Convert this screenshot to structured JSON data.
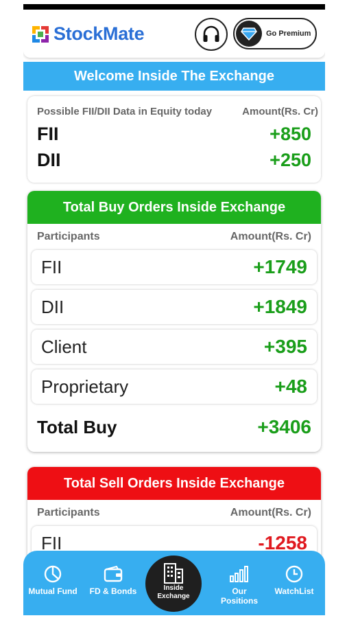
{
  "app": {
    "name": "StockMate",
    "premium_label": "Go Premium"
  },
  "welcome": {
    "title": "Welcome Inside The Exchange"
  },
  "fii_dii": {
    "heading_left": "Possible FII/DII Data in Equity today",
    "heading_right": "Amount(Rs. Cr)",
    "rows": [
      {
        "label": "FII",
        "value": "+850"
      },
      {
        "label": "DII",
        "value": "+250"
      }
    ]
  },
  "buy": {
    "title": "Total Buy Orders Inside Exchange",
    "col_participants": "Participants",
    "col_amount": "Amount(Rs. Cr)",
    "rows": [
      {
        "label": "FII",
        "value": "+1749"
      },
      {
        "label": "DII",
        "value": "+1849"
      },
      {
        "label": "Client",
        "value": "+395"
      },
      {
        "label": "Proprietary",
        "value": "+48"
      }
    ],
    "total_label": "Total Buy",
    "total_value": "+3406"
  },
  "sell": {
    "title": "Total Sell Orders Inside Exchange",
    "col_participants": "Participants",
    "col_amount": "Amount(Rs. Cr)",
    "rows": [
      {
        "label": "FII",
        "value": "-1258"
      }
    ]
  },
  "nav": {
    "items": [
      {
        "label": "Mutual Fund",
        "icon": "pie-chart-icon"
      },
      {
        "label": "FD & Bonds",
        "icon": "wallet-icon"
      },
      {
        "label": "Inside Exchange",
        "icon": "building-icon"
      },
      {
        "label": "Our Positions",
        "icon": "bar-chart-icon"
      },
      {
        "label": "WatchList",
        "icon": "clock-icon"
      }
    ]
  },
  "colors": {
    "accent": "#37aef0",
    "buy": "#1fb11f",
    "sell": "#ee0f14",
    "positive": "#1a9e1a",
    "negative": "#e0191f",
    "brand": "#2a6fd6"
  }
}
